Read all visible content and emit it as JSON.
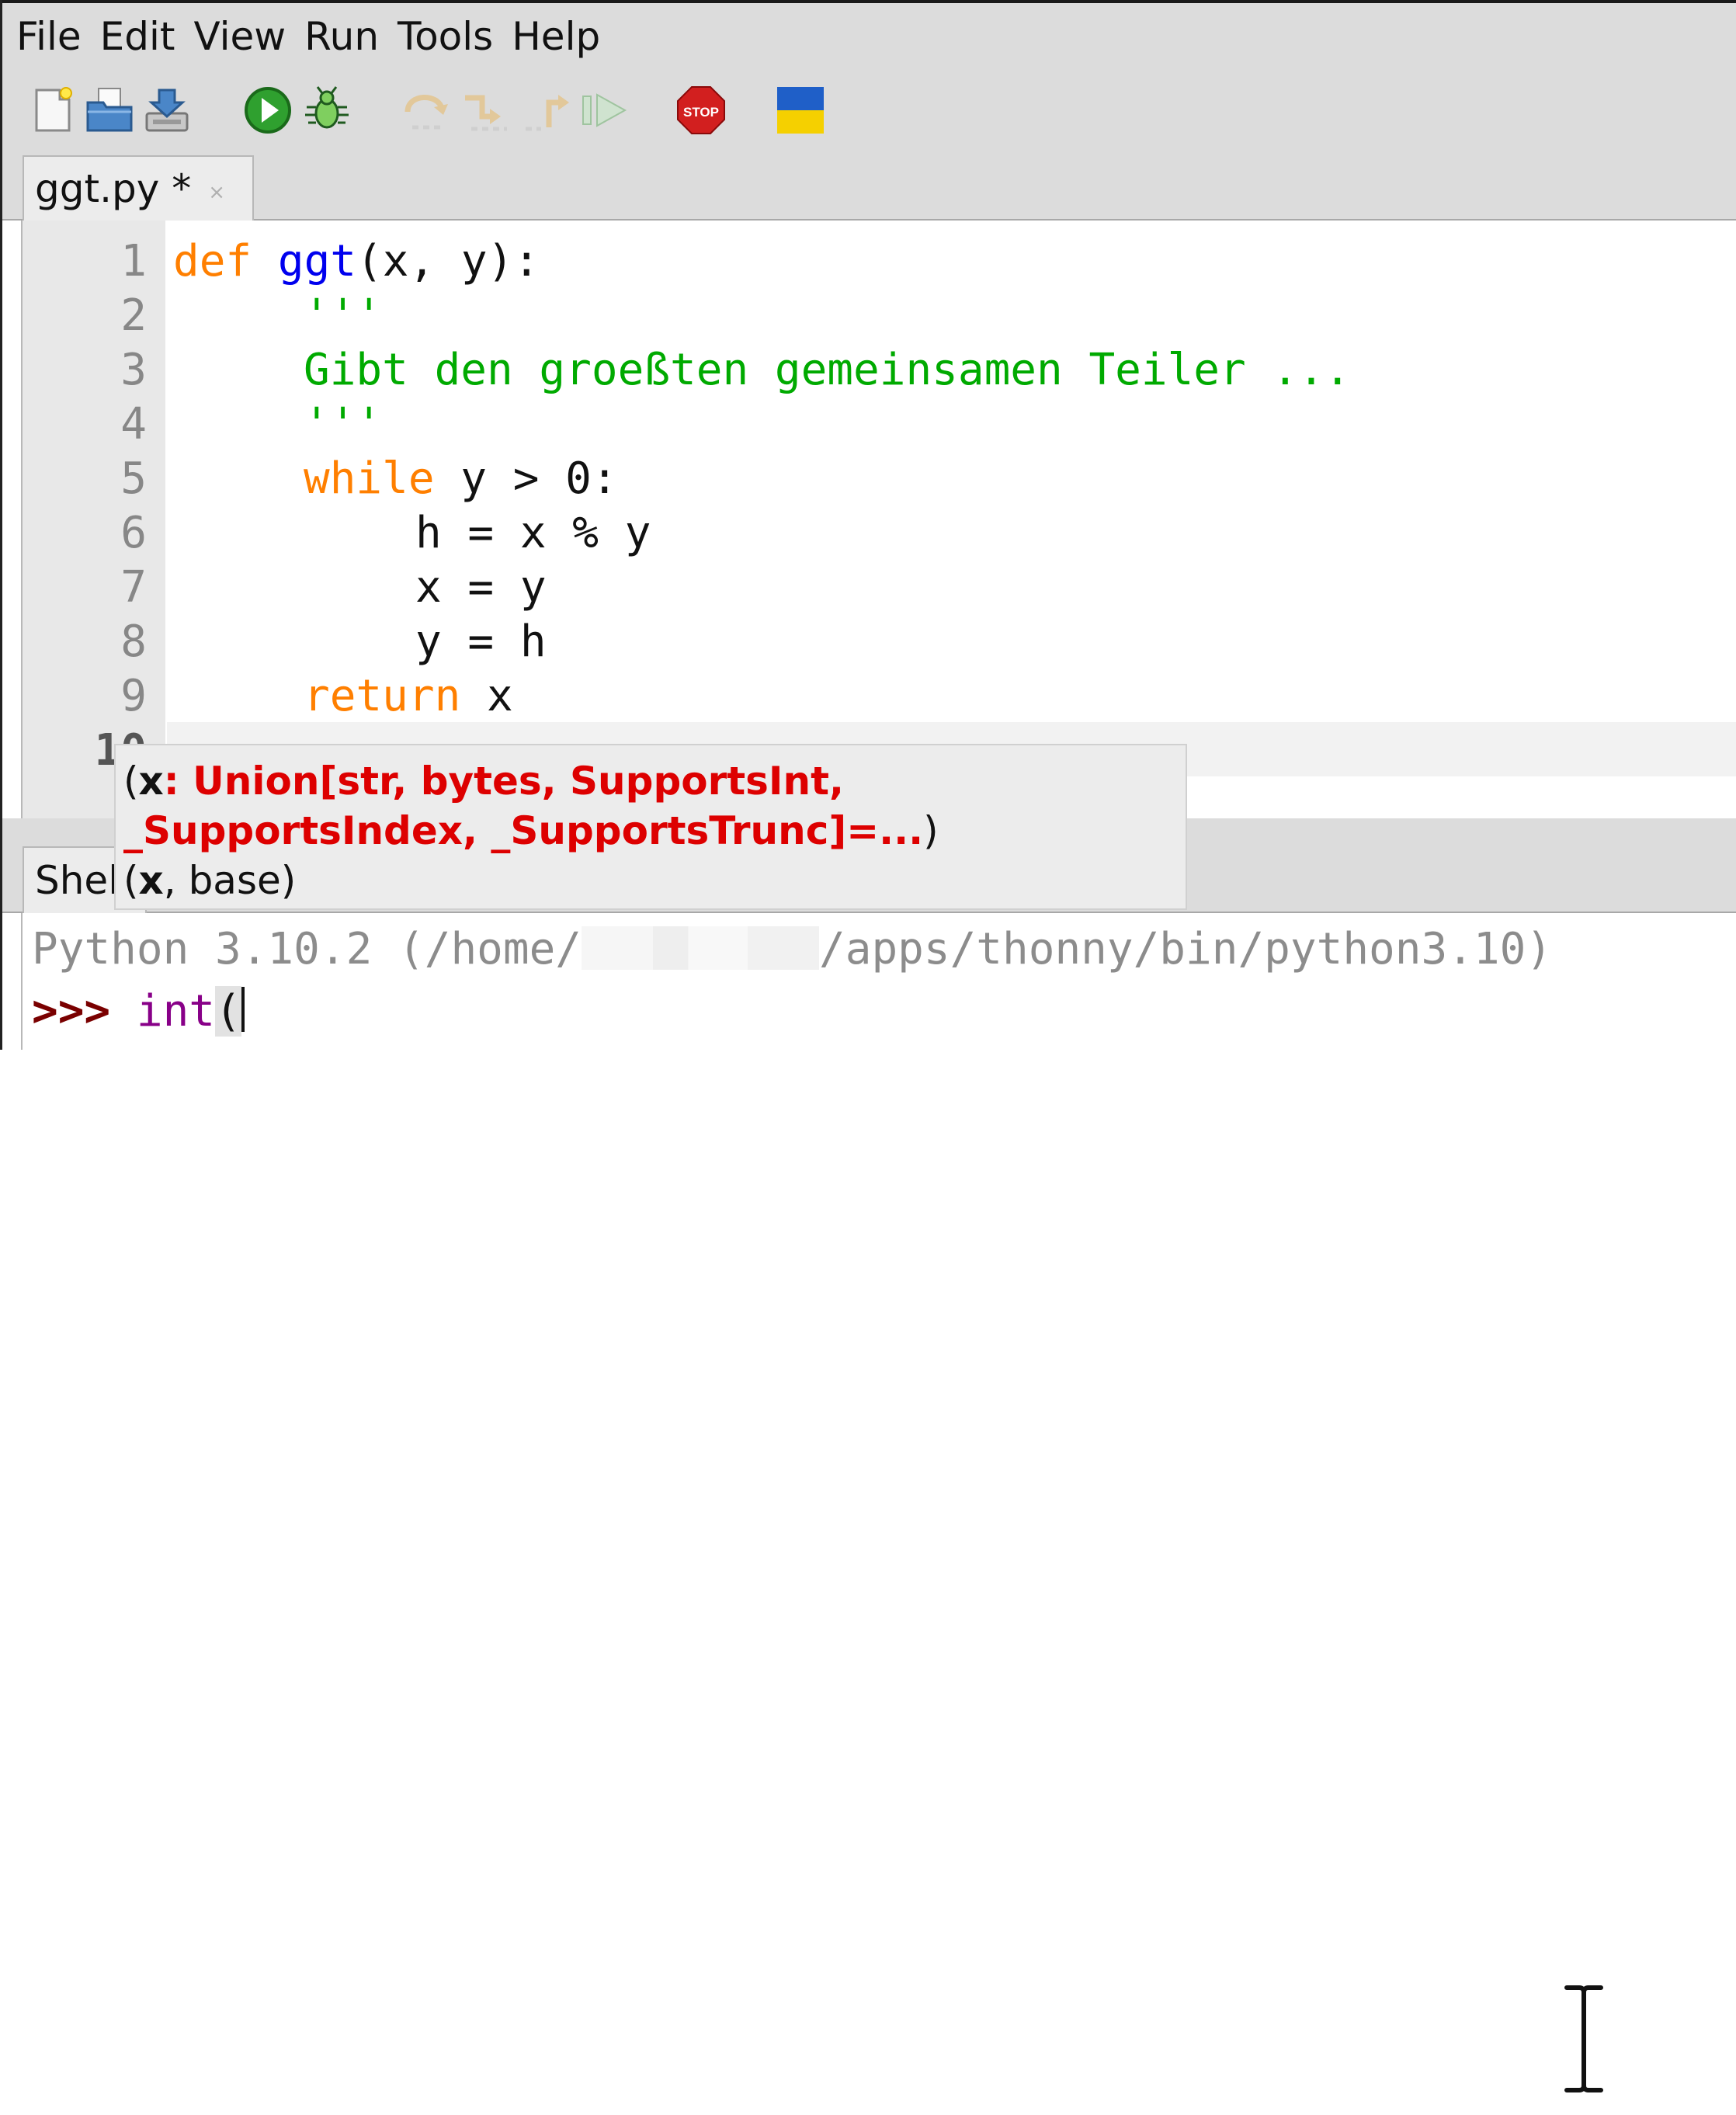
{
  "menu": [
    "File",
    "Edit",
    "View",
    "Run",
    "Tools",
    "Help"
  ],
  "toolbar": {
    "icons": [
      "new-file-icon",
      "open-file-icon",
      "save-file-icon",
      "run-icon",
      "debug-icon",
      "step-over-icon",
      "step-into-icon",
      "step-out-icon",
      "resume-icon",
      "stop-icon",
      "ukraine-flag-icon"
    ],
    "stop_label": "STOP"
  },
  "editor_tab": {
    "label": "ggt.py *",
    "close": "×"
  },
  "editor": {
    "line_numbers": [
      "1",
      "2",
      "3",
      "4",
      "5",
      "6",
      "7",
      "8",
      "9",
      "10"
    ],
    "lines": {
      "l1": {
        "kw": "def",
        "fn": "ggt",
        "rest": "(x, y):"
      },
      "l2": {
        "str": "'''"
      },
      "l3": {
        "str": "Gibt den groeßten gemeinsamen Teiler ..."
      },
      "l4": {
        "str": "'''"
      },
      "l5": {
        "kw": "while",
        "rest": " y > 0:"
      },
      "l6": {
        "text": "h = x % y"
      },
      "l7": {
        "text": "x = y"
      },
      "l8": {
        "text": "y = h"
      },
      "l9": {
        "kw": "return",
        "rest": " x"
      }
    }
  },
  "calltip": {
    "sig1_open": "(",
    "sig1_param": "x",
    "sig1_type_a": ": Union[str, bytes, SupportsInt,",
    "sig1_type_b": "_SupportsIndex, _SupportsTrunc]=...",
    "sig1_close": ")",
    "sig2_open": "(",
    "sig2_param": "x",
    "sig2_rest": ", base)"
  },
  "shell_tab": {
    "label": "Shell"
  },
  "shell": {
    "banner_a": "Python 3.10.2 (/home/",
    "banner_b": "/apps/thonny/bin/python3.10)",
    "prompt": ">>>",
    "input_fn": "int",
    "input_paren": "("
  },
  "colors": {
    "keyword": "#ff7f00",
    "function": "#0000ee",
    "string": "#00aa00",
    "prompt": "#7a0000",
    "builtin": "#880088",
    "calltip_type": "#dd0000"
  }
}
